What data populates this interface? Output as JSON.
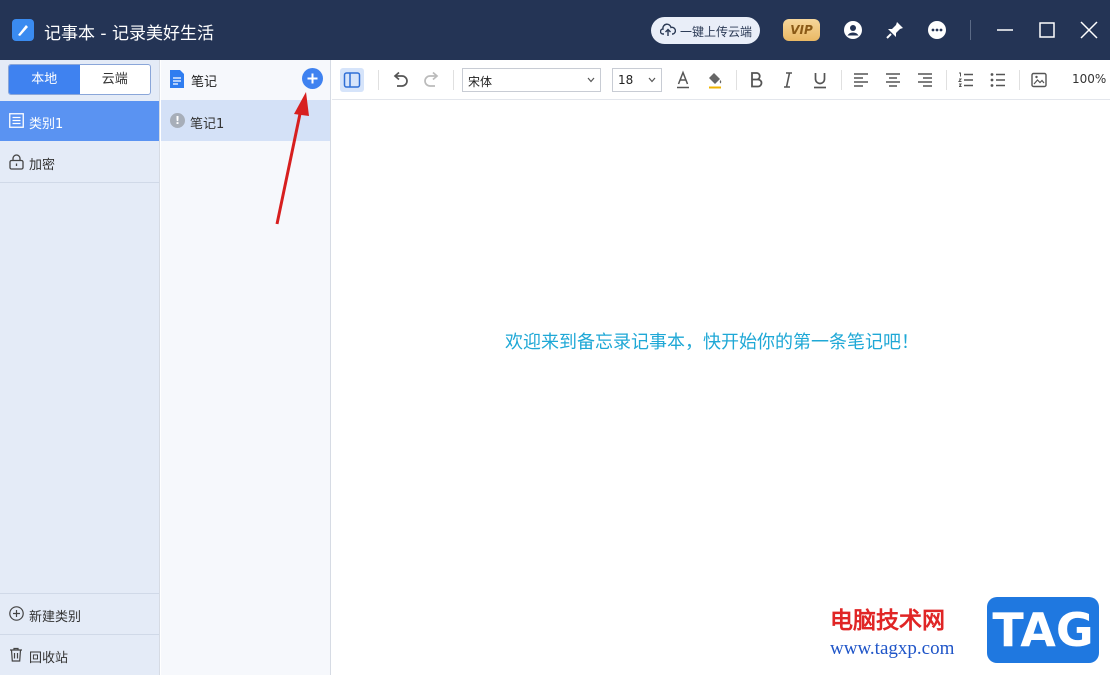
{
  "window": {
    "title": "记事本 - 记录美好生活",
    "upload_label": "一键上传云端",
    "vip_label": "VIP"
  },
  "sidebar": {
    "tabs": [
      "本地",
      "云端"
    ],
    "categories": [
      {
        "label": "类别1",
        "icon": "list-icon"
      },
      {
        "label": "加密",
        "icon": "lock-icon"
      }
    ],
    "new_category_label": "新建类别",
    "recycle_label": "回收站"
  },
  "notes": {
    "header_label": "笔记",
    "items": [
      {
        "label": "笔记1",
        "status_icon": "warning-icon"
      }
    ]
  },
  "toolbar": {
    "font": "宋体",
    "font_size": "18",
    "zoom": "100%"
  },
  "editor": {
    "welcome_text": "欢迎来到备忘录记事本，快开始你的第一条笔记吧！"
  },
  "watermark": {
    "line1": "电脑技术网",
    "line2": "www.tagxp.com",
    "tag": "TAG"
  },
  "colors": {
    "titlebar": "#243455",
    "accent": "#3f82f0",
    "welcome": "#1fa8d6"
  }
}
